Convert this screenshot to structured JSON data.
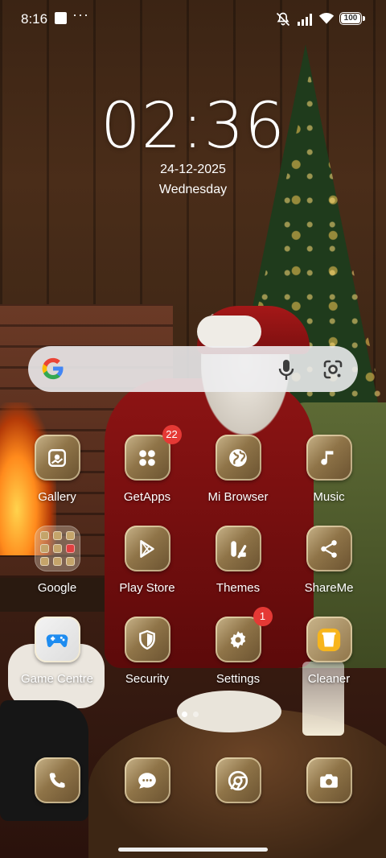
{
  "status_bar": {
    "time": "8:16",
    "more": "···",
    "battery": "100"
  },
  "clock": {
    "time": "02:36",
    "date": "24-12-2025",
    "day": "Wednesday"
  },
  "search": {
    "google_icon": "google-icon",
    "mic_icon": "mic-icon",
    "lens_icon": "google-lens-icon"
  },
  "apps": [
    {
      "label": "Gallery",
      "icon": "gallery-icon",
      "badge": ""
    },
    {
      "label": "GetApps",
      "icon": "getapps-icon",
      "badge": "22"
    },
    {
      "label": "Mi Browser",
      "icon": "globe-icon",
      "badge": ""
    },
    {
      "label": "Music",
      "icon": "music-note-icon",
      "badge": ""
    },
    {
      "label": "Google",
      "icon": "folder-icon",
      "badge": ""
    },
    {
      "label": "Play Store",
      "icon": "play-store-icon",
      "badge": ""
    },
    {
      "label": "Themes",
      "icon": "themes-icon",
      "badge": ""
    },
    {
      "label": "ShareMe",
      "icon": "share-icon",
      "badge": ""
    },
    {
      "label": "Game Centre",
      "icon": "gamepad-icon",
      "badge": ""
    },
    {
      "label": "Security",
      "icon": "shield-icon",
      "badge": ""
    },
    {
      "label": "Settings",
      "icon": "gear-icon",
      "badge": "1"
    },
    {
      "label": "Cleaner",
      "icon": "trash-icon",
      "badge": ""
    }
  ],
  "dock": [
    {
      "icon": "phone-icon"
    },
    {
      "icon": "messages-icon"
    },
    {
      "icon": "chrome-icon"
    },
    {
      "icon": "camera-icon"
    }
  ],
  "colors": {
    "icon_gold": "#a88a5a",
    "badge_red": "#e53935"
  }
}
